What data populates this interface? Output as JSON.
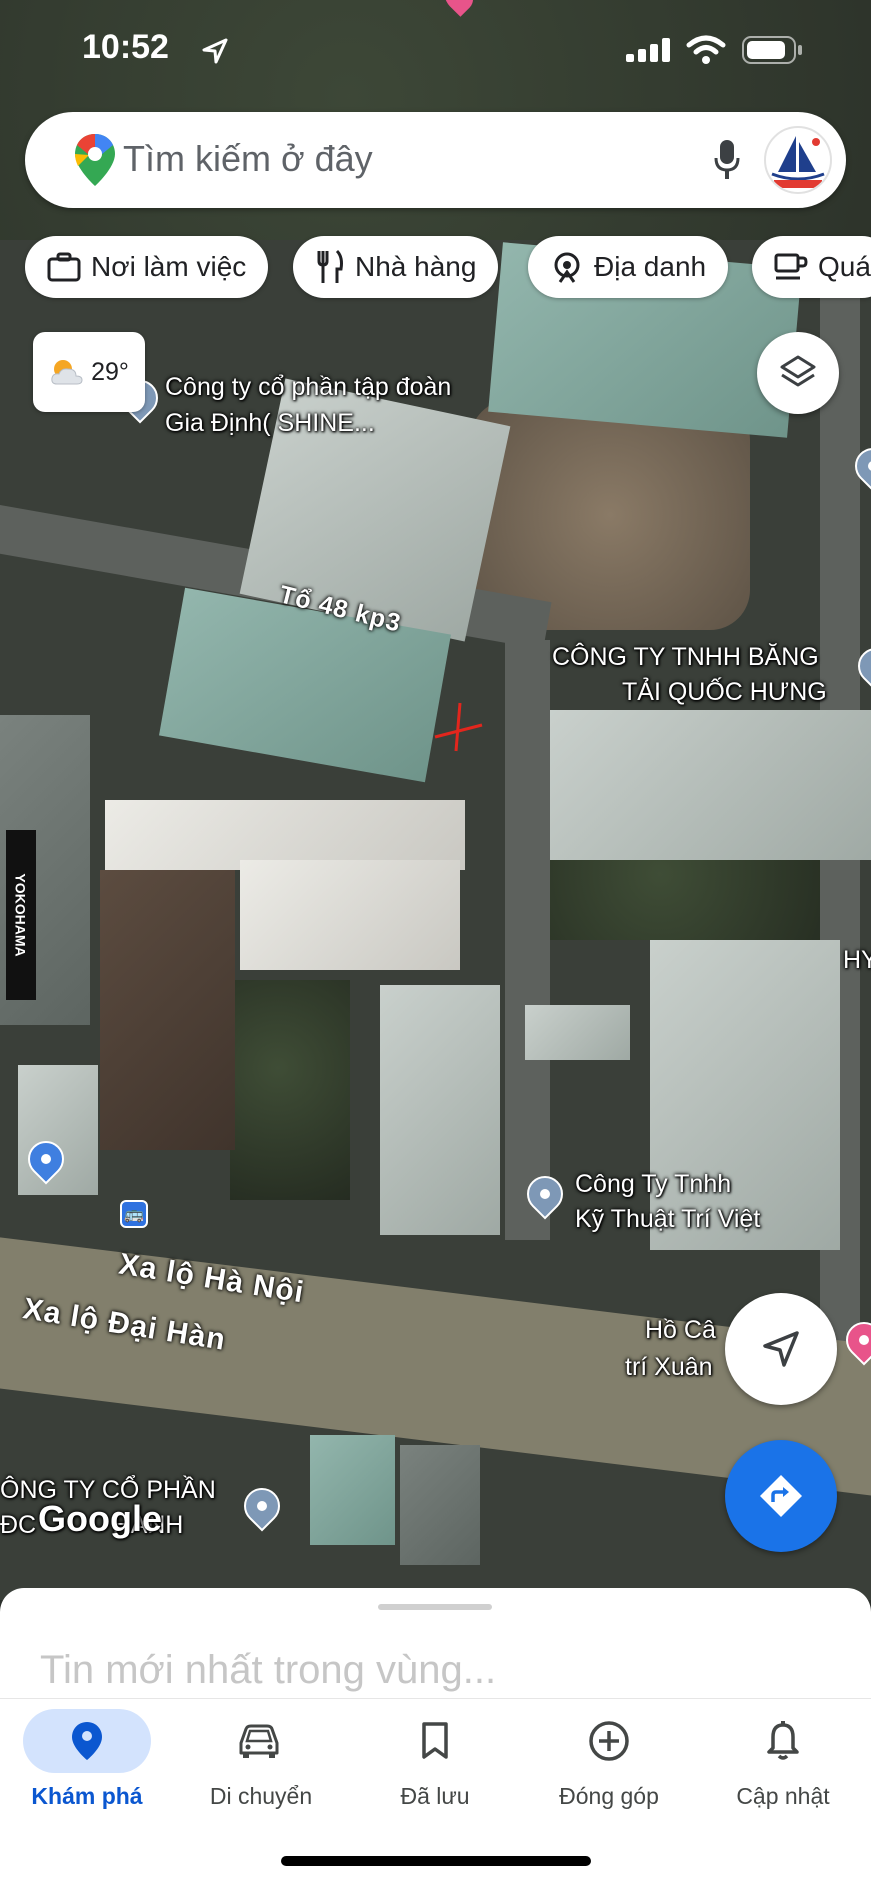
{
  "status_bar": {
    "time": "10:52"
  },
  "search": {
    "placeholder": "Tìm kiếm ở đây"
  },
  "chips": [
    {
      "label": "Nơi làm việc",
      "icon": "briefcase-icon"
    },
    {
      "label": "Nhà hàng",
      "icon": "fork-knife-icon"
    },
    {
      "label": "Địa danh",
      "icon": "landmark-icon"
    },
    {
      "label": "Quá",
      "icon": "coffee-icon"
    }
  ],
  "weather": {
    "temp": "29°",
    "icon": "partly-cloudy-icon"
  },
  "map": {
    "labels": {
      "company_gia_dinh_line1": "Công ty cổ phần tập đoàn",
      "company_gia_dinh_line2": "Gia Định( SHINE...",
      "to48": "Tổ 48 kp3",
      "bang_tai_line1": "CÔNG TY TNHH BĂNG",
      "bang_tai_line2": "TẢI QUỐC HƯNG",
      "tri_viet_line1": "Công Ty Tnhh",
      "tri_viet_line2": "Kỹ Thuật Trí Việt",
      "road_hanoi": "Xa lộ Hà Nội",
      "road_daihan": "Xa lộ Đại Hàn",
      "ho_ca_line1": "Hồ Câ",
      "ho_ca_line2": "trí Xuân",
      "cong_ty_cp_line1": "ÔNG TY CỔ PHẦN",
      "cong_ty_cp_line2": "ĐC           HANH",
      "hy": "HY",
      "yokohama": "YOKOHAMA",
      "google": "Google"
    }
  },
  "sheet": {
    "title": "Tin mới nhất trong vùng..."
  },
  "nav": [
    {
      "label": "Khám phá",
      "icon": "explore-pin-icon",
      "active": true
    },
    {
      "label": "Di chuyển",
      "icon": "car-icon",
      "active": false
    },
    {
      "label": "Đã lưu",
      "icon": "bookmark-icon",
      "active": false
    },
    {
      "label": "Đóng góp",
      "icon": "add-circle-icon",
      "active": false
    },
    {
      "label": "Cập nhật",
      "icon": "bell-icon",
      "active": false
    }
  ],
  "colors": {
    "accent": "#1a73e8",
    "nav_active_bg": "#d3e3fd",
    "nav_active_text": "#0b57d0"
  }
}
